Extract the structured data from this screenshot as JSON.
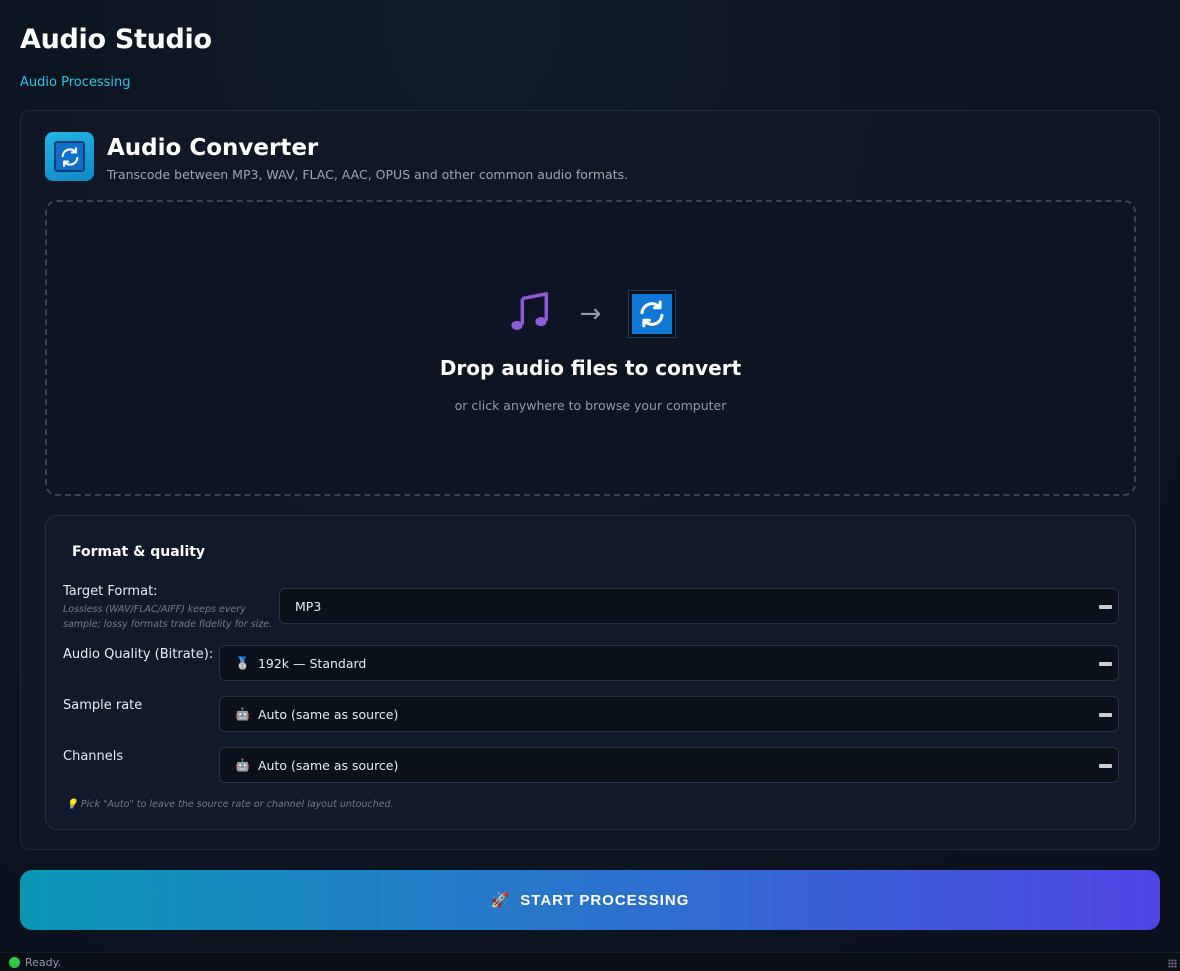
{
  "app": {
    "title": "Audio Studio",
    "breadcrumb": "Audio Processing"
  },
  "tool": {
    "icon": "sync-icon",
    "title": "Audio Converter",
    "description": "Transcode between MP3, WAV, FLAC, AAC, OPUS and other common audio formats."
  },
  "dropzone": {
    "source_icon": "music-note-icon",
    "arrow": "→",
    "target_icon": "sync-icon",
    "title": "Drop audio files to convert",
    "subtitle": "or click anywhere to browse your computer"
  },
  "settings": {
    "title": "Format & quality",
    "target_format": {
      "label": "Target Format:",
      "hint": "Lossless (WAV/FLAC/AIFF) keeps every sample; lossy formats trade fidelity for size.",
      "value": "MP3"
    },
    "audio_quality": {
      "label": "Audio Quality (Bitrate):",
      "emoji": "🥈",
      "value": "192k — Standard"
    },
    "sample_rate": {
      "label": "Sample rate",
      "emoji": "🤖",
      "value": "Auto (same as source)"
    },
    "channels": {
      "label": "Channels",
      "emoji": "🤖",
      "value": "Auto (same as source)"
    },
    "tip": {
      "emoji": "💡",
      "text": "Pick \"Auto\" to leave the source rate or channel layout untouched."
    }
  },
  "start_button": {
    "emoji": "🚀",
    "label": "START PROCESSING"
  },
  "status": {
    "text": "Ready.",
    "color": "#2ecc40"
  },
  "colors": {
    "accent": "#26c6e6",
    "button_gradient_start": "#0b97b6",
    "button_gradient_end": "#4f46e5"
  }
}
